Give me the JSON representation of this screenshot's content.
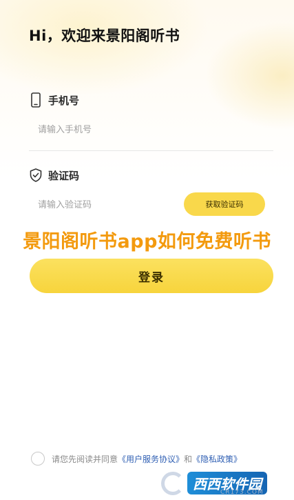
{
  "header": {
    "greeting": "Hi，欢迎来景阳阁听书"
  },
  "phone": {
    "label": "手机号",
    "placeholder": "请输入手机号",
    "icon": "phone-icon"
  },
  "code": {
    "label": "验证码",
    "placeholder": "请输入验证码",
    "icon": "shield-check-icon",
    "get_code_label": "获取验证码"
  },
  "overlay": {
    "title": "景阳阁听书app如何免费听书"
  },
  "login": {
    "label": "登录"
  },
  "agreement": {
    "prefix": "请您先阅读并同意",
    "terms_link": "《用户服务协议》",
    "conjunction": "和",
    "privacy_link": "《隐私政策》"
  },
  "watermark": {
    "brand": "西西软件园",
    "domain": "CR173.COM"
  },
  "colors": {
    "accent": "#f9d84b",
    "overlay_text": "#f39a0e",
    "link": "#2f5fb3"
  }
}
